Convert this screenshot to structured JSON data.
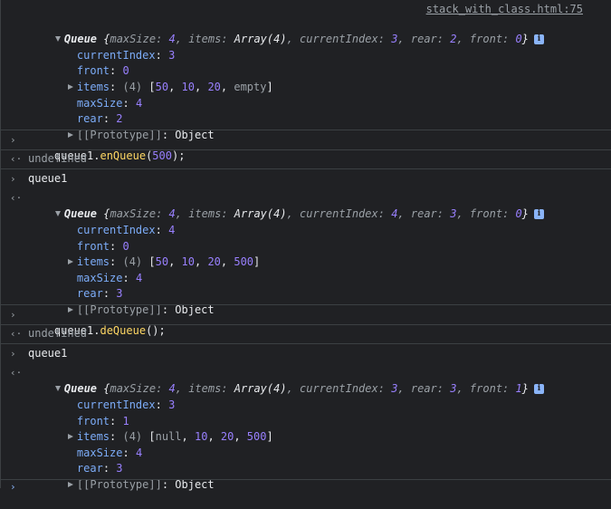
{
  "source_link": "stack_with_class.html:75",
  "info_badge": "i",
  "prompts": {
    "input": "›",
    "output": "‹·"
  },
  "block1": {
    "summary": {
      "class": "Queue",
      "maxSize_key": "maxSize",
      "maxSize": "4",
      "items_key": "items",
      "items": "Array(4)",
      "currentIndex_key": "currentIndex",
      "currentIndex": "3",
      "rear_key": "rear",
      "rear": "2",
      "front_key": "front",
      "front": "0"
    },
    "props": [
      {
        "key": "currentIndex",
        "value": "3"
      },
      {
        "key": "front",
        "value": "0"
      }
    ],
    "items_line": {
      "key": "items",
      "count": "(4)",
      "v0": "50",
      "v1": "10",
      "v2": "20",
      "v3": "empty"
    },
    "props2": [
      {
        "key": "maxSize",
        "value": "4"
      },
      {
        "key": "rear",
        "value": "2"
      }
    ],
    "proto": "[[Prototype]]",
    "proto_value": "Object"
  },
  "cmd1": {
    "obj": "queue1.",
    "fn": "enQueue",
    "open": "(",
    "arg": "500",
    "close": ");"
  },
  "result1": "undefined",
  "cmd2": "queue1",
  "block2": {
    "summary": {
      "class": "Queue",
      "maxSize": "4",
      "items": "Array(4)",
      "currentIndex": "4",
      "rear": "3",
      "front": "0"
    },
    "props": [
      {
        "key": "currentIndex",
        "value": "4"
      },
      {
        "key": "front",
        "value": "0"
      }
    ],
    "items_line": {
      "key": "items",
      "count": "(4)",
      "v0": "50",
      "v1": "10",
      "v2": "20",
      "v3": "500"
    },
    "props2": [
      {
        "key": "maxSize",
        "value": "4"
      },
      {
        "key": "rear",
        "value": "3"
      }
    ],
    "proto": "[[Prototype]]",
    "proto_value": "Object"
  },
  "cmd3": {
    "obj": "queue1.",
    "fn": "deQueue",
    "call": "();"
  },
  "result3": "undefined",
  "cmd4": "queue1",
  "block3": {
    "summary": {
      "class": "Queue",
      "maxSize": "4",
      "items": "Array(4)",
      "currentIndex": "3",
      "rear": "3",
      "front": "1"
    },
    "props": [
      {
        "key": "currentIndex",
        "value": "3"
      },
      {
        "key": "front",
        "value": "1"
      }
    ],
    "items_line": {
      "key": "items",
      "count": "(4)",
      "v0": "null",
      "v1": "10",
      "v2": "20",
      "v3": "500"
    },
    "props2": [
      {
        "key": "maxSize",
        "value": "4"
      },
      {
        "key": "rear",
        "value": "3"
      }
    ],
    "proto": "[[Prototype]]",
    "proto_value": "Object"
  }
}
